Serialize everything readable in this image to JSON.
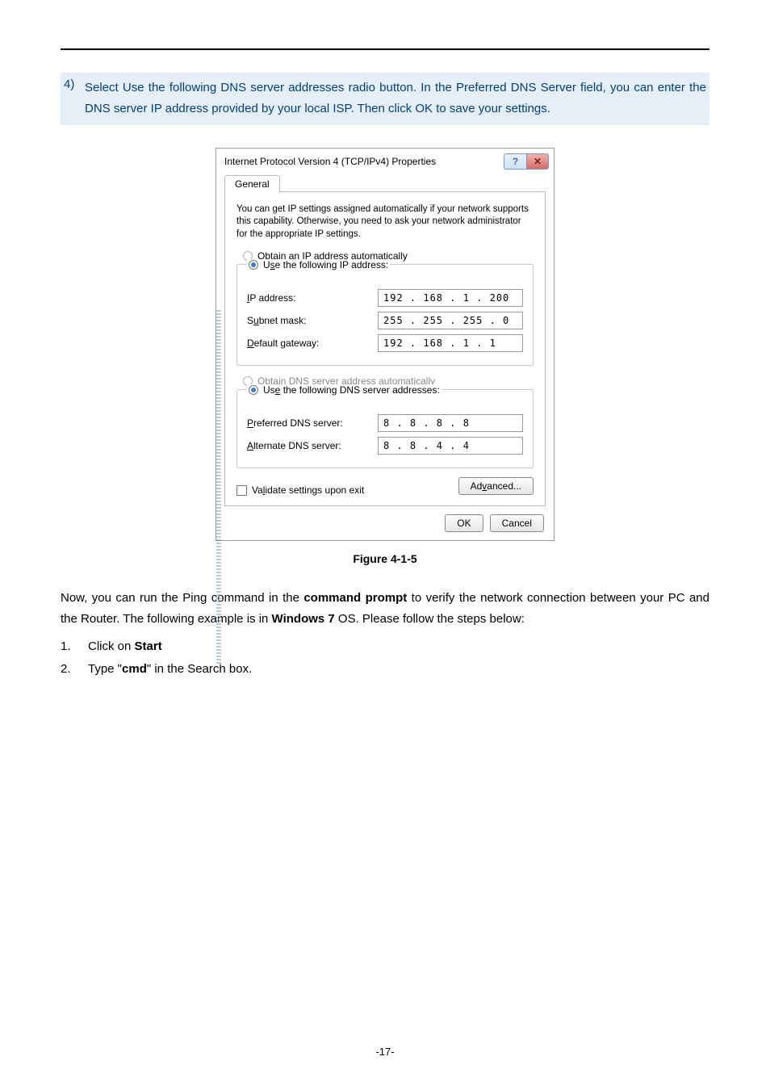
{
  "instruction": {
    "number": "4)",
    "text": "Select Use the following DNS server addresses radio button. In the Preferred DNS Server field, you can enter the DNS server IP address provided by your local ISP. Then click OK to save your settings."
  },
  "dialog": {
    "title": "Internet Protocol Version 4 (TCP/IPv4) Properties",
    "tab": "General",
    "desc": "You can get IP settings assigned automatically if your network supports this capability. Otherwise, you need to ask your network administrator for the appropriate IP settings.",
    "radio_auto_ip": "Obtain an IP address automatically",
    "radio_use_ip": "Use the following IP address:",
    "ip_label": "IP address:",
    "ip_value": "192 . 168 .  1   . 200",
    "subnet_label": "Subnet mask:",
    "subnet_value": "255 . 255 . 255 .  0",
    "gateway_label": "Default gateway:",
    "gateway_value": "192 . 168 .  1   .  1",
    "radio_auto_dns": "Obtain DNS server address automatically",
    "radio_use_dns": "Use the following DNS server addresses:",
    "pref_dns_label": "Preferred DNS server:",
    "pref_dns_value": " 8  .  8  .  8  .  8",
    "alt_dns_label": "Alternate DNS server:",
    "alt_dns_value": " 8  .  8  .  4  .  4",
    "validate_label": "Validate settings upon exit",
    "advanced_label": "Advanced...",
    "ok_label": "OK",
    "cancel_label": "Cancel"
  },
  "caption": "Figure 4-1-5",
  "para_before": "Now, you can run the Ping command in the ",
  "para_bold1": "command prompt",
  "para_mid": " to verify the network connection between your PC and the Router. The following example is in ",
  "para_bold2": "Windows 7",
  "para_after": " OS. Please follow the steps below:",
  "steps": {
    "s1_num": "1.",
    "s1_a": "Click on ",
    "s1_b": "Start",
    "s2_num": "2.",
    "s2_a": "Type \"",
    "s2_b": "cmd",
    "s2_c": "\" in the Search box."
  },
  "page_number": "-17-",
  "mnem": {
    "O": "O",
    "s": "s",
    "I": "I",
    "u": "u",
    "D": "D",
    "b": "b",
    "e": "e",
    "P": "P",
    "A": "A",
    "l": "l",
    "v": "v"
  }
}
